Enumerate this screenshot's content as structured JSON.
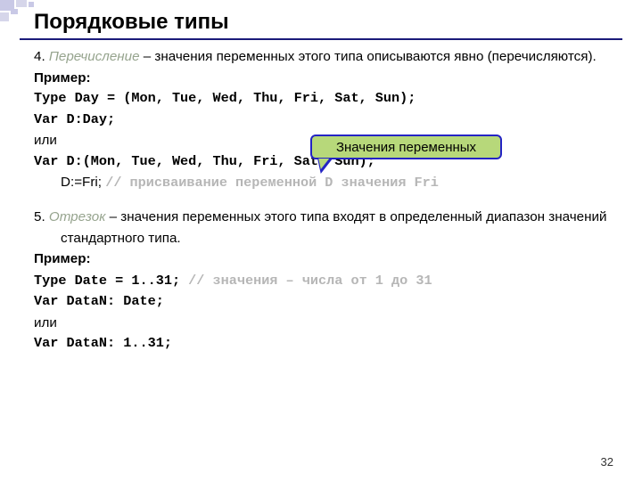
{
  "title": "Порядковые типы",
  "section4": {
    "num": "4. ",
    "term": "Перечисление",
    "rest": " – значения переменных этого типа описываются явно (перечисляются)."
  },
  "example_label": "Пример:",
  "code1": "Type Day = (Mon, Tue, Wed, Thu, Fri, Sat, Sun);",
  "code2": "Var D:Day;",
  "or": "или",
  "code3": "Var D:(Mon, Tue, Wed, Thu, Fri, Sat, Sun);",
  "code4_prefix": "D:=Fri; ",
  "code4_comment": "// присваивание переменной D значения Fri",
  "section5": {
    "num": "5. ",
    "term": "Отрезок",
    "rest": " – значения переменных этого типа входят в определенный диапазон значений стандартного типа."
  },
  "code5_bold": "Type Date = 1..31; ",
  "code5_comment": "// значения – числа от 1 до 31",
  "code6": "Var DataN: Date;",
  "code7": "Var DataN: 1..31;",
  "callout": "Значения переменных",
  "page": "32"
}
